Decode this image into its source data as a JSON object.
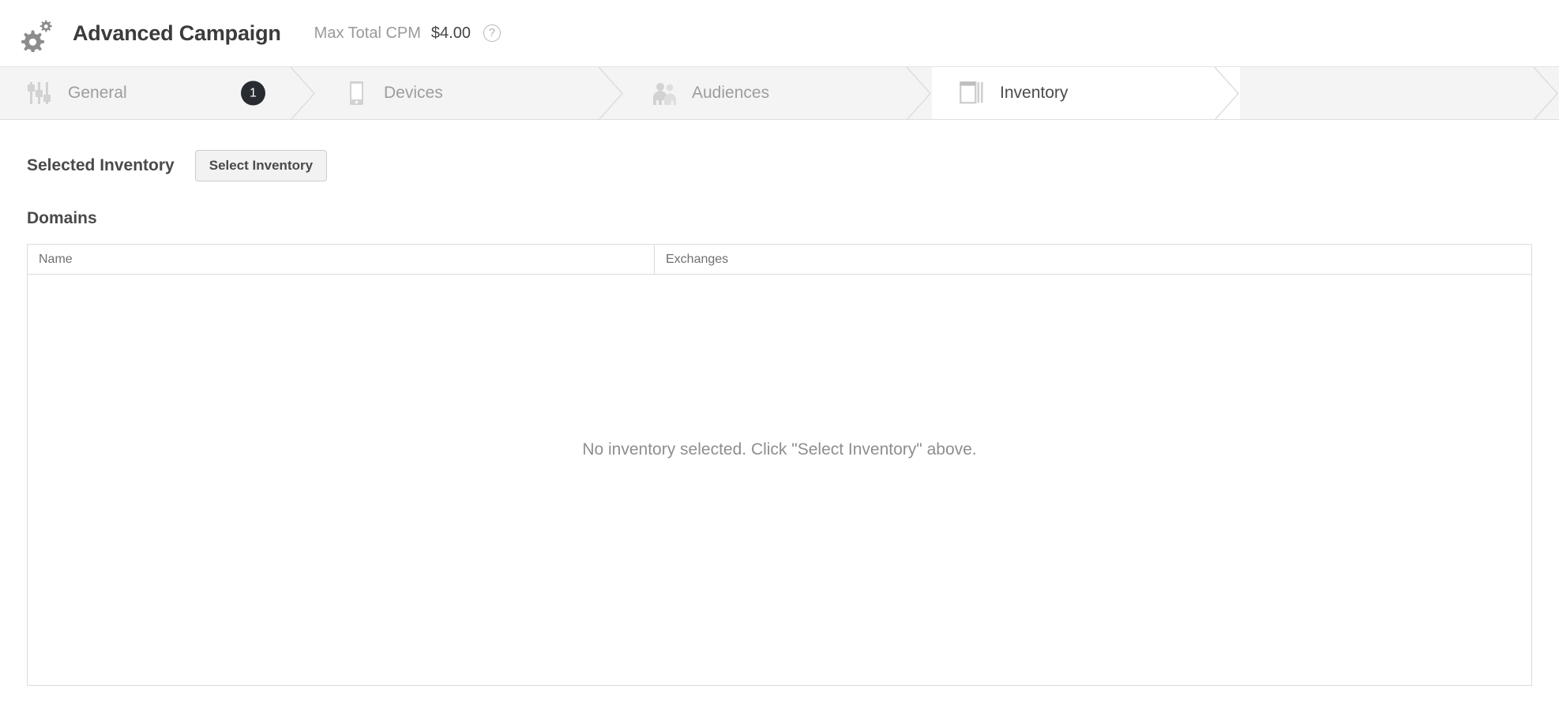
{
  "header": {
    "logo_icon": "gears-icon",
    "title": "Advanced Campaign",
    "cpm_label": "Max Total CPM",
    "cpm_value": "$4.00",
    "help_icon": "help-circle-icon",
    "help_glyph": "?"
  },
  "stepper": {
    "steps": [
      {
        "label": "General",
        "icon": "sliders-icon",
        "badge": "1",
        "active": false
      },
      {
        "label": "Devices",
        "icon": "tablet-icon",
        "badge": "",
        "active": false
      },
      {
        "label": "Audiences",
        "icon": "people-icon",
        "badge": "",
        "active": false
      },
      {
        "label": "Inventory",
        "icon": "windows-icon",
        "badge": "",
        "active": true
      }
    ]
  },
  "main": {
    "selected_inventory_title": "Selected Inventory",
    "select_inventory_button": "Select Inventory",
    "domains_title": "Domains",
    "table": {
      "columns": [
        "Name",
        "Exchanges"
      ],
      "rows": [],
      "empty_message": "No inventory selected. Click \"Select Inventory\" above."
    }
  },
  "colors": {
    "page_bg": "#ffffff",
    "stepper_bg": "#f4f4f4",
    "stepper_active_bg": "#ffffff",
    "badge_bg": "#282c31",
    "border": "#dcdcdc",
    "text_dark": "#3b3b3b",
    "text_muted": "#9a9a9a"
  }
}
